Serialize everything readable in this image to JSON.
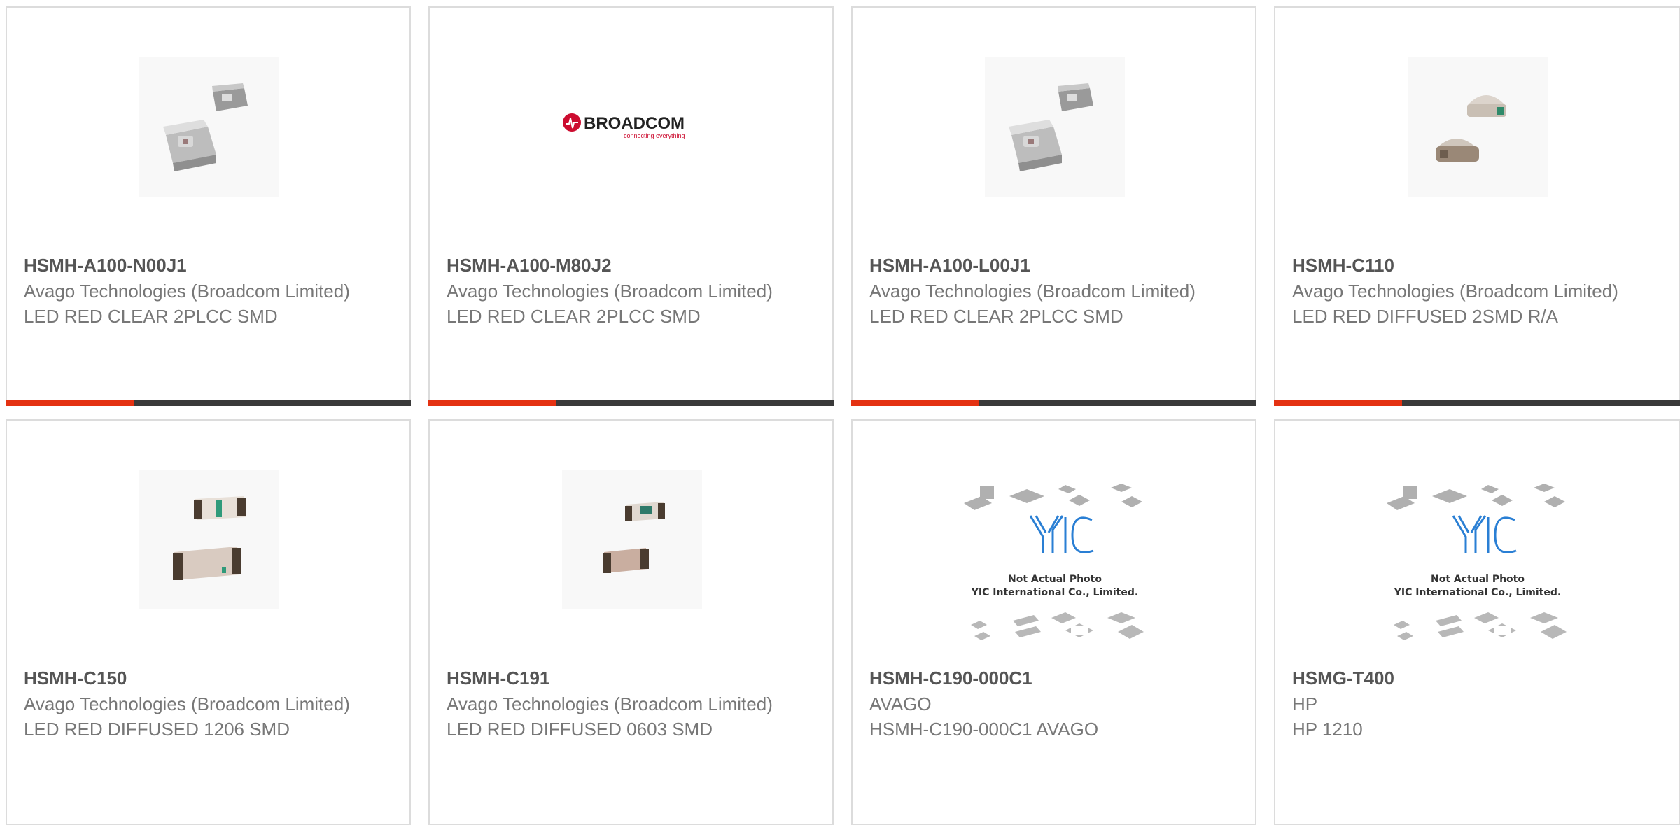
{
  "colors": {
    "accent": "#e43212",
    "bar_dark": "#3a3a3a",
    "border": "#dcdcdc",
    "broadcom_red": "#cc0c2f",
    "yic_blue": "#2a7fd4"
  },
  "products": [
    {
      "part_number": "HSMH-A100-N00J1",
      "manufacturer": "Avago Technologies (Broadcom Limited)",
      "description": "LED RED CLEAR 2PLCC SMD",
      "image": "plcc-led-photo"
    },
    {
      "part_number": "HSMH-A100-M80J2",
      "manufacturer": "Avago Technologies (Broadcom Limited)",
      "description": "LED RED CLEAR 2PLCC SMD",
      "image": "broadcom-logo",
      "logo": {
        "brand": "BROADCOM",
        "tagline": "connecting everything"
      }
    },
    {
      "part_number": "HSMH-A100-L00J1",
      "manufacturer": "Avago Technologies (Broadcom Limited)",
      "description": "LED RED CLEAR 2PLCC SMD",
      "image": "plcc-led-photo"
    },
    {
      "part_number": "HSMH-C110",
      "manufacturer": "Avago Technologies (Broadcom Limited)",
      "description": "LED RED DIFFUSED 2SMD R/A",
      "image": "right-angle-led-photo"
    },
    {
      "part_number": "HSMH-C150",
      "manufacturer": "Avago Technologies (Broadcom Limited)",
      "description": "LED RED DIFFUSED 1206 SMD",
      "image": "chip-led-photo"
    },
    {
      "part_number": "HSMH-C191",
      "manufacturer": "Avago Technologies (Broadcom Limited)",
      "description": "LED RED DIFFUSED 0603 SMD",
      "image": "chip-led-photo"
    },
    {
      "part_number": "HSMH-C190-000C1",
      "manufacturer": "AVAGO",
      "description": "HSMH-C190-000C1 AVAGO",
      "image": "yic-placeholder",
      "placeholder": {
        "logo": "YIC",
        "line1": "Not Actual Photo",
        "line2": "YIC International Co., Limited."
      }
    },
    {
      "part_number": "HSMG-T400",
      "manufacturer": "HP",
      "description": "HP 1210",
      "image": "yic-placeholder",
      "placeholder": {
        "logo": "YIC",
        "line1": "Not Actual Photo",
        "line2": "YIC International Co., Limited."
      }
    }
  ]
}
